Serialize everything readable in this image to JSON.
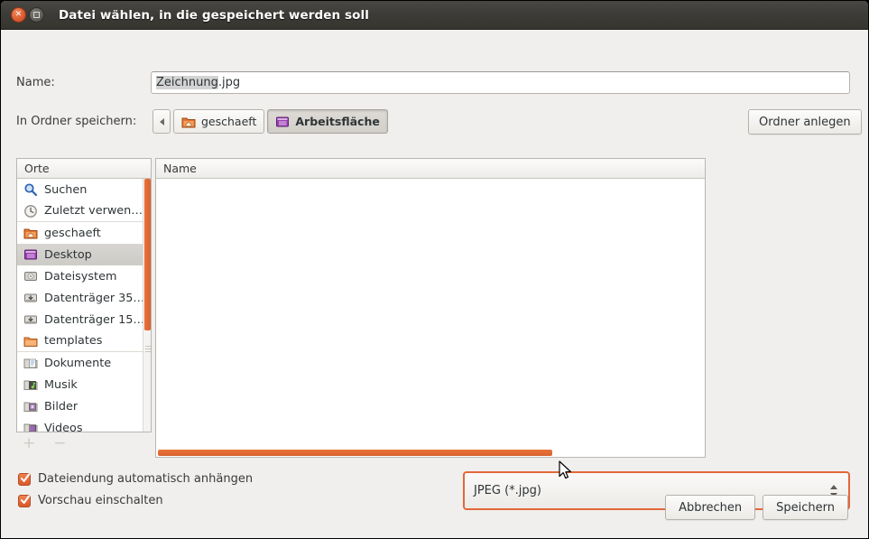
{
  "window": {
    "title": "Datei wählen, in die gespeichert werden soll",
    "close_icon": "close-icon",
    "maximize_icon": "maximize-icon",
    "accent_color": "#e2673a",
    "titlebar_color": "#3c3b37",
    "background_color": "#f0efed"
  },
  "name_row": {
    "label": "Name:",
    "value_selected": "Zeichnung",
    "value_rest": ".jpg",
    "full_value": "Zeichnung.jpg",
    "placeholder": ""
  },
  "folder_row": {
    "label": "In Ordner speichern:",
    "back_icon": "chevron-left-icon",
    "crumbs": [
      {
        "label": "geschaeft",
        "icon": "home-folder-icon",
        "active": false
      },
      {
        "label": "Arbeitsfläche",
        "icon": "desktop-icon",
        "active": true
      }
    ],
    "new_folder_label": "Ordner anlegen"
  },
  "places": {
    "header": "Orte",
    "items": [
      {
        "label": "Suchen",
        "icon": "search-icon",
        "selected": false,
        "separator": false
      },
      {
        "label": "Zuletzt verwen…",
        "icon": "recent-clock-icon",
        "selected": false,
        "separator": true
      },
      {
        "label": "geschaeft",
        "icon": "home-folder-icon",
        "selected": false,
        "separator": false
      },
      {
        "label": "Desktop",
        "icon": "desktop-icon",
        "selected": true,
        "separator": false
      },
      {
        "label": "Dateisystem",
        "icon": "harddisk-icon",
        "selected": false,
        "separator": false
      },
      {
        "label": "Datenträger 35…",
        "icon": "drive-icon",
        "selected": false,
        "separator": false
      },
      {
        "label": "Datenträger 15…",
        "icon": "drive-icon",
        "selected": false,
        "separator": false
      },
      {
        "label": "templates",
        "icon": "folder-icon",
        "selected": false,
        "separator": true
      },
      {
        "label": "Dokumente",
        "icon": "documents-icon",
        "selected": false,
        "separator": false
      },
      {
        "label": "Musik",
        "icon": "music-icon",
        "selected": false,
        "separator": false
      },
      {
        "label": "Bilder",
        "icon": "pictures-icon",
        "selected": false,
        "separator": false
      },
      {
        "label": "Videos",
        "icon": "videos-icon",
        "selected": false,
        "separator": false
      }
    ],
    "add_label": "+",
    "remove_label": "−"
  },
  "files": {
    "column_header": "Name",
    "rows": []
  },
  "options": [
    {
      "label": "Dateiendung automatisch anhängen",
      "checked": true
    },
    {
      "label": "Vorschau einschalten",
      "checked": true
    }
  ],
  "filetype": {
    "selected": "JPEG (*.jpg)"
  },
  "actions": {
    "cancel_label": "Abbrechen",
    "save_label": "Speichern"
  },
  "cursor": {
    "icon": "mouse-pointer-icon"
  }
}
